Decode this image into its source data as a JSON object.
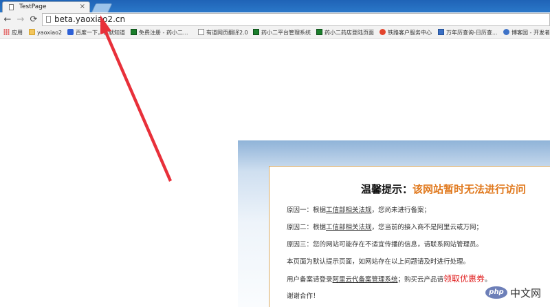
{
  "tab": {
    "title": "TestPage",
    "close": "×"
  },
  "toolbar": {
    "back": "←",
    "forward": "→",
    "reload": "⟳",
    "url": "beta.yaoxiao2.cn"
  },
  "bookmarks": [
    {
      "label": "应用",
      "icon": "apps-grid-icon"
    },
    {
      "label": "yaoxiao2",
      "icon": "folder-icon"
    },
    {
      "label": "百度一下，你就知道",
      "icon": "baidu-icon"
    },
    {
      "label": "免费注册 - 药小二...",
      "icon": "green-square-icon"
    },
    {
      "label": "有道网页翻译2.0",
      "icon": "page-icon"
    },
    {
      "label": "药小二平台管理系统",
      "icon": "green-square-icon"
    },
    {
      "label": "药小二药店登陆页面",
      "icon": "green-square-icon"
    },
    {
      "label": "铁路客户服务中心",
      "icon": "railway-icon"
    },
    {
      "label": "万年历查询-日历查...",
      "icon": "calendar-icon"
    },
    {
      "label": "博客园 - 开发者",
      "icon": "cnblogs-icon"
    }
  ],
  "notice": {
    "heading_prefix": "温馨提示：",
    "heading_warn": "该网站暂时无法进行访问",
    "r1_pre": "原因一：根据",
    "r1_link": "工信部相关法规",
    "r1_post": "，您尚未进行备案；",
    "r2_pre": "原因二：根据",
    "r2_link": "工信部相关法规",
    "r2_post": "，您当前的接入商不是阿里云或万网；",
    "r3": "原因三：您的网站可能存在不适宜传播的信息，请联系网站管理员。",
    "default_text": "本页面为默认提示页面，如网站存在以上问题请及时进行处理。",
    "user_pre": "用户备案请登录",
    "user_link": "阿里云代备案管理系统",
    "user_mid": "；购买云产品请",
    "coupon": "领取优惠券",
    "user_end": "。",
    "thanks": "谢谢合作！"
  },
  "watermark": {
    "logo": "php",
    "site": "中文网"
  },
  "colors": {
    "warning": "#e0781c",
    "coupon": "#e02020",
    "arrow": "#e8303a",
    "chrome_blue": "#2b78c9"
  }
}
